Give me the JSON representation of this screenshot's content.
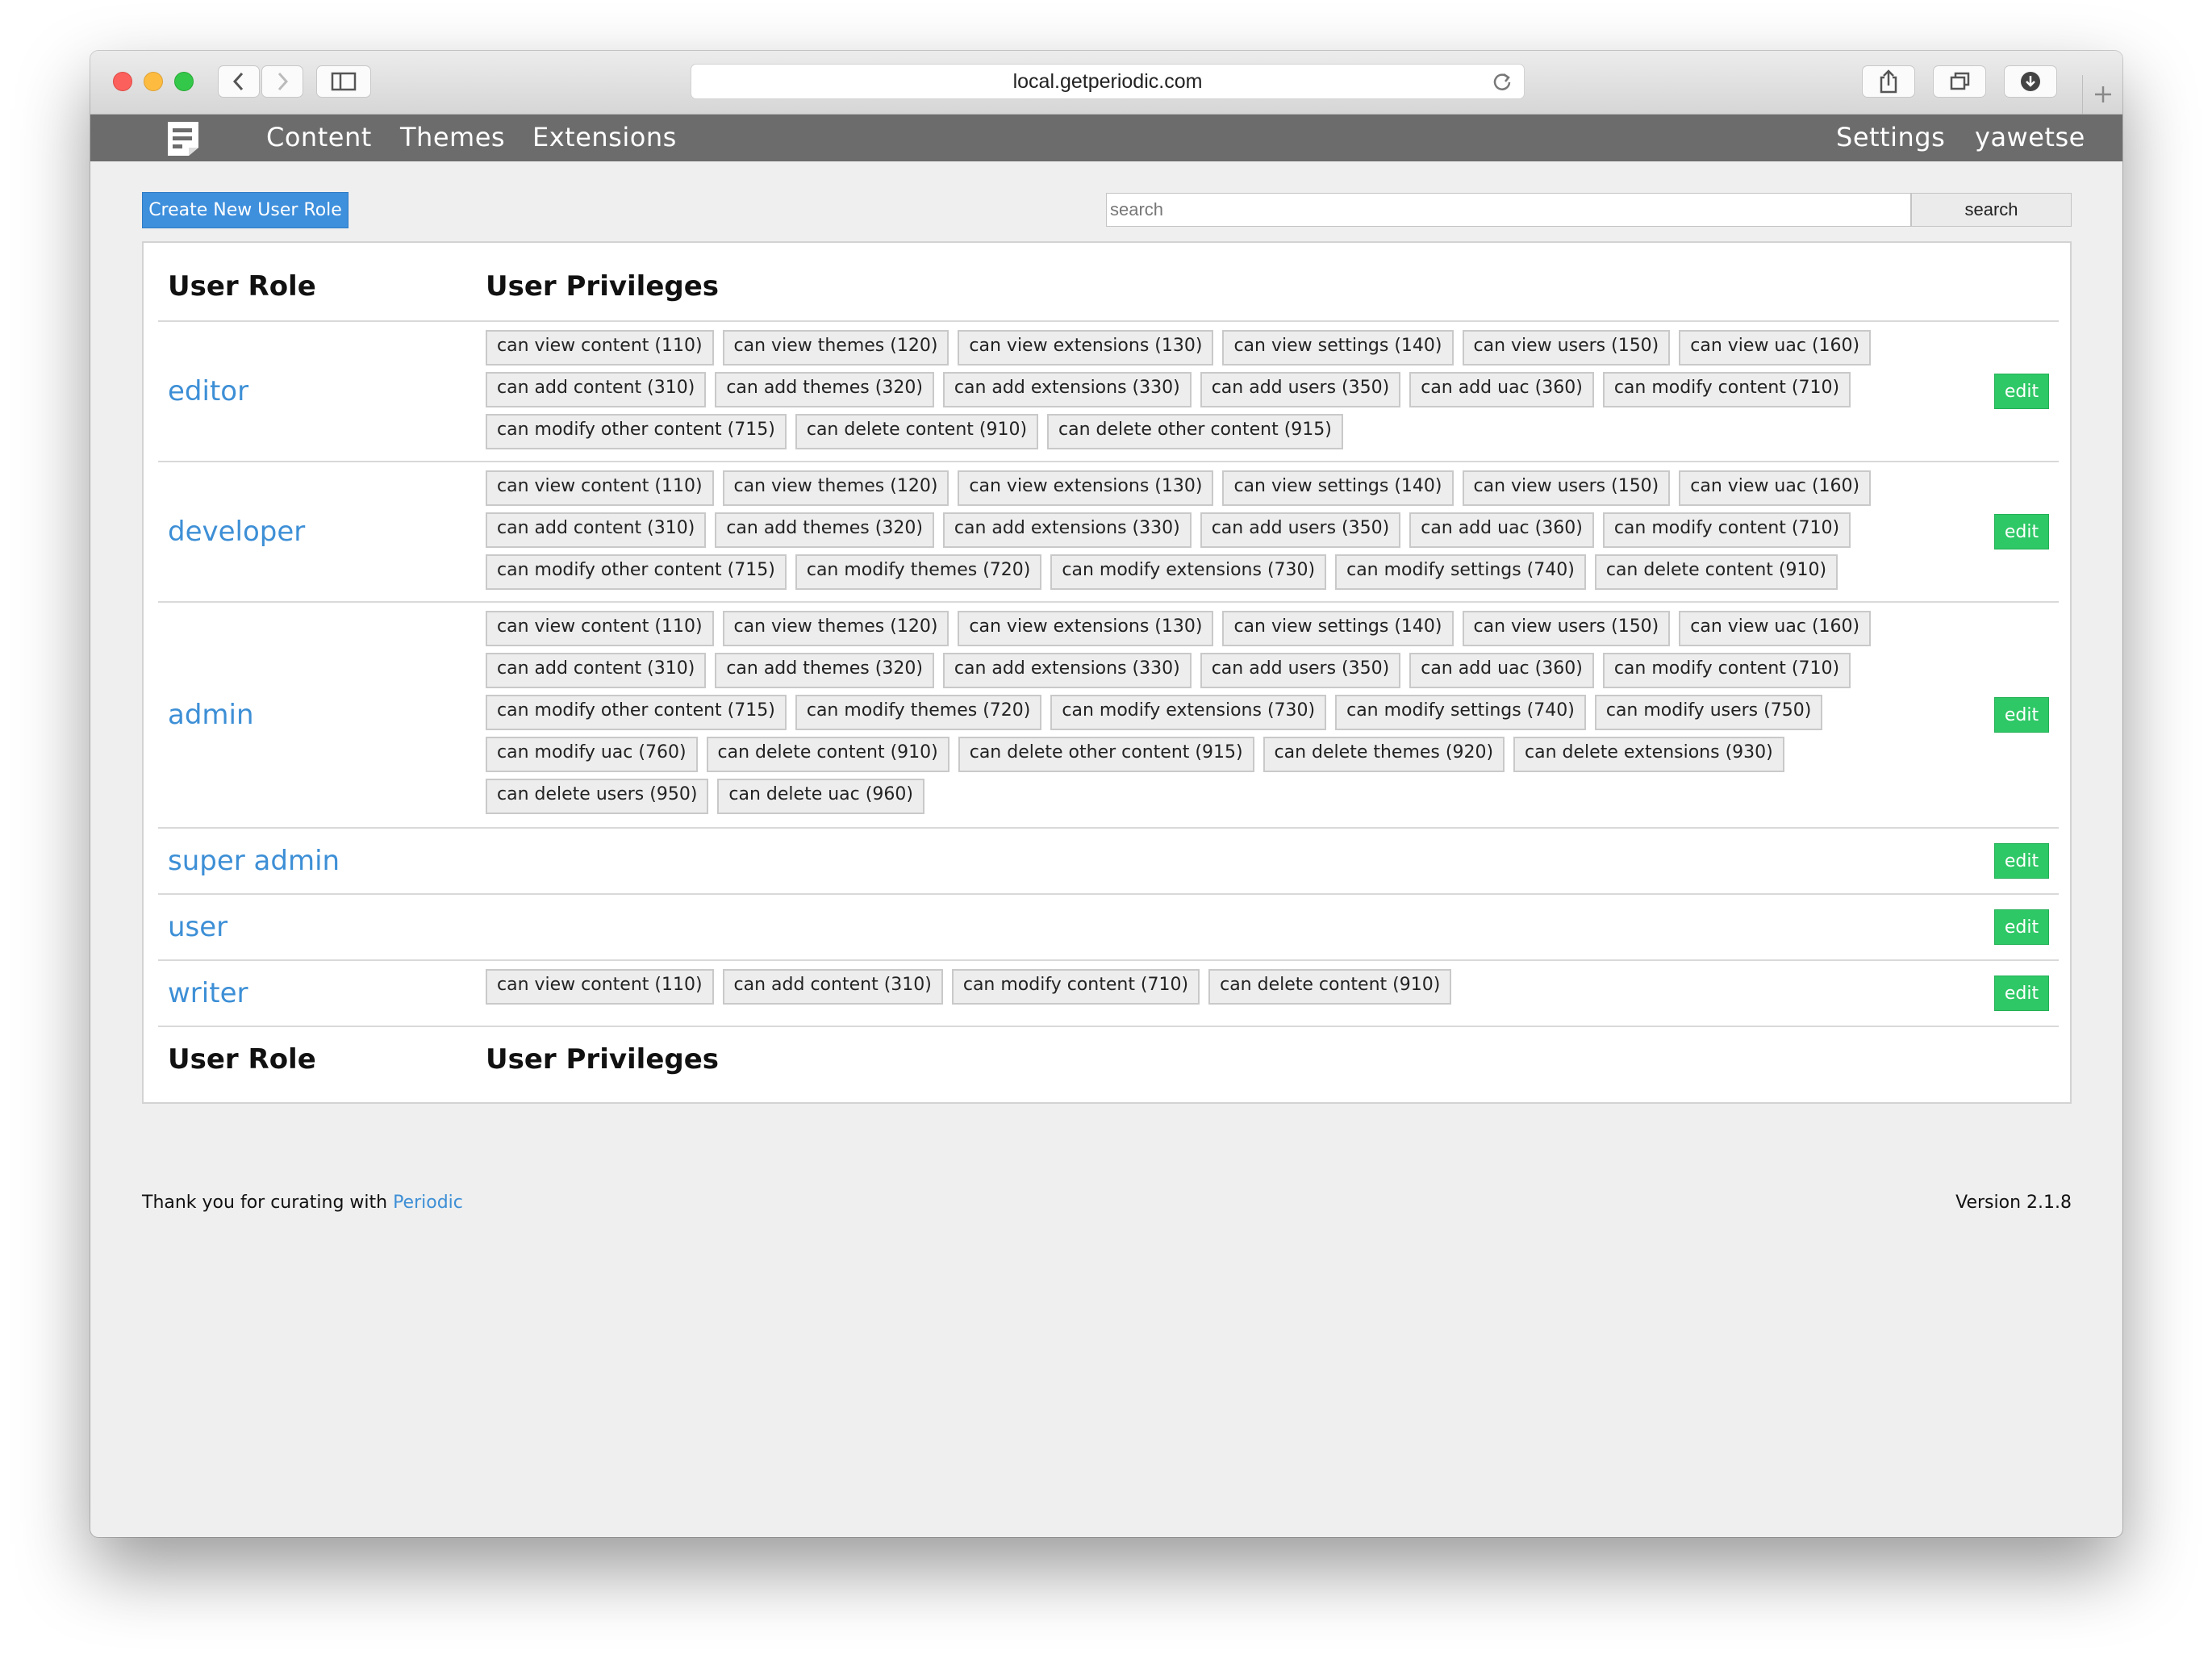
{
  "browser": {
    "url": "local.getperiodic.com"
  },
  "nav": {
    "links": [
      "Content",
      "Themes",
      "Extensions"
    ],
    "settings": "Settings",
    "user": "yawetse"
  },
  "toolbar": {
    "create_label": "Create New User Role",
    "search_placeholder": "search",
    "search_label": "search"
  },
  "table": {
    "header_role": "User Role",
    "header_privileges": "User Privileges",
    "edit_label": "edit",
    "roles": [
      {
        "name": "editor",
        "privileges": [
          "can view content (110)",
          "can view themes (120)",
          "can view extensions (130)",
          "can view settings (140)",
          "can view users (150)",
          "can view uac (160)",
          "can add content (310)",
          "can add themes (320)",
          "can add extensions (330)",
          "can add users (350)",
          "can add uac (360)",
          "can modify content (710)",
          "can modify other content (715)",
          "can delete content (910)",
          "can delete other content (915)"
        ]
      },
      {
        "name": "developer",
        "privileges": [
          "can view content (110)",
          "can view themes (120)",
          "can view extensions (130)",
          "can view settings (140)",
          "can view users (150)",
          "can view uac (160)",
          "can add content (310)",
          "can add themes (320)",
          "can add extensions (330)",
          "can add users (350)",
          "can add uac (360)",
          "can modify content (710)",
          "can modify other content (715)",
          "can modify themes (720)",
          "can modify extensions (730)",
          "can modify settings (740)",
          "can delete content (910)"
        ]
      },
      {
        "name": "admin",
        "privileges": [
          "can view content (110)",
          "can view themes (120)",
          "can view extensions (130)",
          "can view settings (140)",
          "can view users (150)",
          "can view uac (160)",
          "can add content (310)",
          "can add themes (320)",
          "can add extensions (330)",
          "can add users (350)",
          "can add uac (360)",
          "can modify content (710)",
          "can modify other content (715)",
          "can modify themes (720)",
          "can modify extensions (730)",
          "can modify settings (740)",
          "can modify users (750)",
          "can modify uac (760)",
          "can delete content (910)",
          "can delete other content (915)",
          "can delete themes (920)",
          "can delete extensions (930)",
          "can delete users (950)",
          "can delete uac (960)"
        ]
      },
      {
        "name": "super admin",
        "privileges": []
      },
      {
        "name": "user",
        "privileges": []
      },
      {
        "name": "writer",
        "privileges": [
          "can view content (110)",
          "can add content (310)",
          "can modify content (710)",
          "can delete content (910)"
        ]
      }
    ]
  },
  "footer": {
    "thanks": "Thank you for curating with ",
    "brand": "Periodic",
    "version": "Version 2.1.8"
  },
  "colors": {
    "nav_bg": "#6c6c6c",
    "primary": "#3e8fdc",
    "link": "#3d8fd6",
    "edit_green": "#2ec866"
  }
}
